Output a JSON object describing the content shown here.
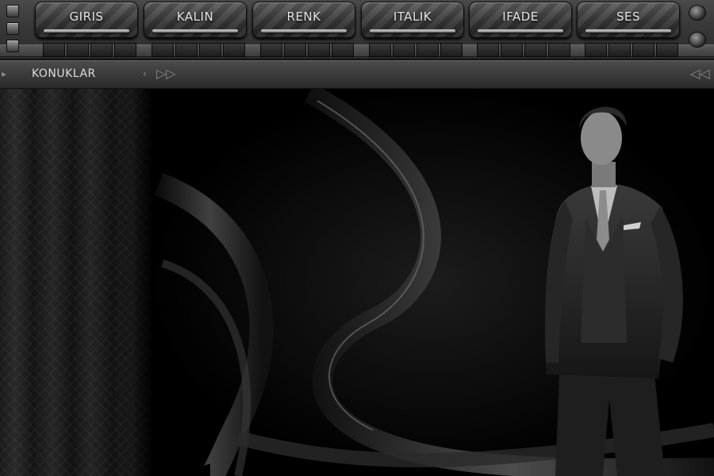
{
  "menu": {
    "items": [
      {
        "label": "GIRIS"
      },
      {
        "label": "KALIN"
      },
      {
        "label": "RENK"
      },
      {
        "label": "ITALIK"
      },
      {
        "label": "IFADE"
      },
      {
        "label": "SES"
      }
    ]
  },
  "nav": {
    "label": "KONUKLAR",
    "forward_icon": "double-chevron-right-icon",
    "back_icon": "double-chevron-left-icon"
  },
  "colors": {
    "toolbar": "#3a3a3a",
    "background": "#000000",
    "text": "#e6e6e6"
  }
}
